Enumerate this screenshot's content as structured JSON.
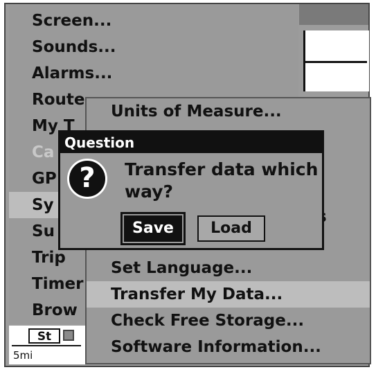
{
  "main_menu": {
    "items": [
      {
        "label": "Screen..."
      },
      {
        "label": "Sounds..."
      },
      {
        "label": "Alarms..."
      },
      {
        "label": "Route"
      },
      {
        "label": "My T"
      },
      {
        "label": "Ca"
      },
      {
        "label": "GP"
      },
      {
        "label": "Sy"
      },
      {
        "label": "Su"
      },
      {
        "label": "Trip"
      },
      {
        "label": "Timer"
      },
      {
        "label": "Brow"
      }
    ]
  },
  "sub_menu": {
    "items": [
      {
        "label": "Units of Measure..."
      },
      {
        "label": "ts"
      },
      {
        "label": "Set Language..."
      },
      {
        "label": "Transfer My Data..."
      },
      {
        "label": "Check Free Storage..."
      },
      {
        "label": "Software Information..."
      }
    ]
  },
  "dialog": {
    "title": "Question",
    "icon": "?",
    "message": "Transfer data which way?",
    "save_label": "Save",
    "load_label": "Load"
  },
  "status": {
    "tab": "St",
    "scale": "5mi"
  }
}
